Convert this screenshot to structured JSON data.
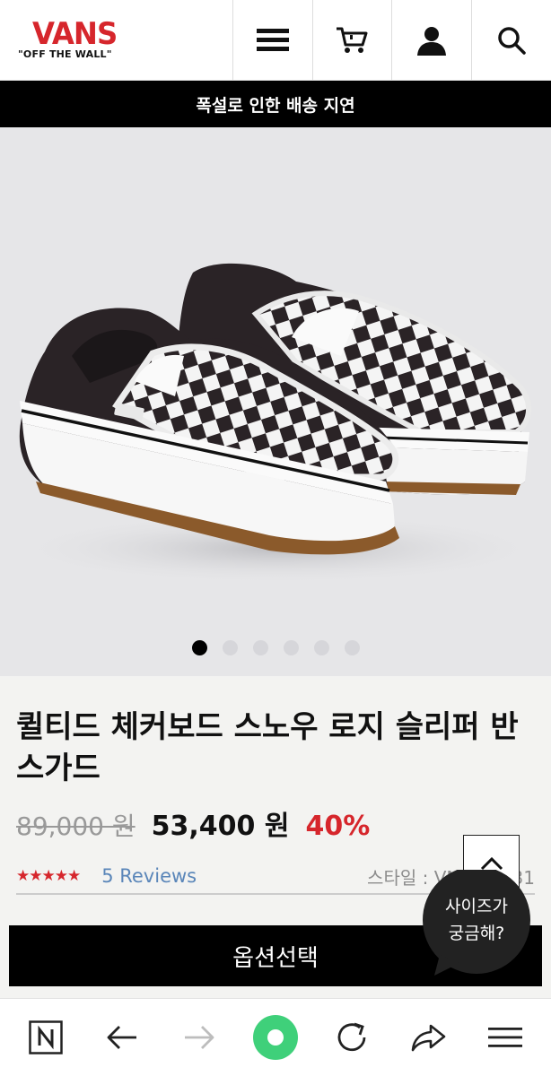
{
  "header": {
    "logo_text": "VANS",
    "logo_tagline": "\"OFF THE WALL\"",
    "icons": [
      "menu-icon",
      "cart-icon",
      "user-icon",
      "search-icon"
    ]
  },
  "notice": {
    "text": "폭설로 인한 배송 지연"
  },
  "gallery": {
    "total_slides": 6,
    "active_slide": 1
  },
  "product": {
    "title": "퀼티드 체커보드 스노우 로지 슬리퍼 반스가드",
    "original_price": "89,000 원",
    "sale_price": "53,400 원",
    "discount": "40%",
    "rating_stars": "★★★★★",
    "reviews_label": "5 Reviews",
    "style_code": "스타일 : VN0A5...31"
  },
  "actions": {
    "option_button": "옵션선택",
    "size_bubble_line1": "사이즈가",
    "size_bubble_line2": "궁금해?"
  },
  "browser_bar": {
    "icons": [
      "home-n-icon",
      "back-icon",
      "forward-icon",
      "green-dot-icon",
      "reload-icon",
      "share-icon",
      "menu-lines-icon"
    ]
  },
  "colors": {
    "brand_red": "#d6262c",
    "link_blue": "#5a86b9",
    "accent_green": "#3fd07a"
  }
}
